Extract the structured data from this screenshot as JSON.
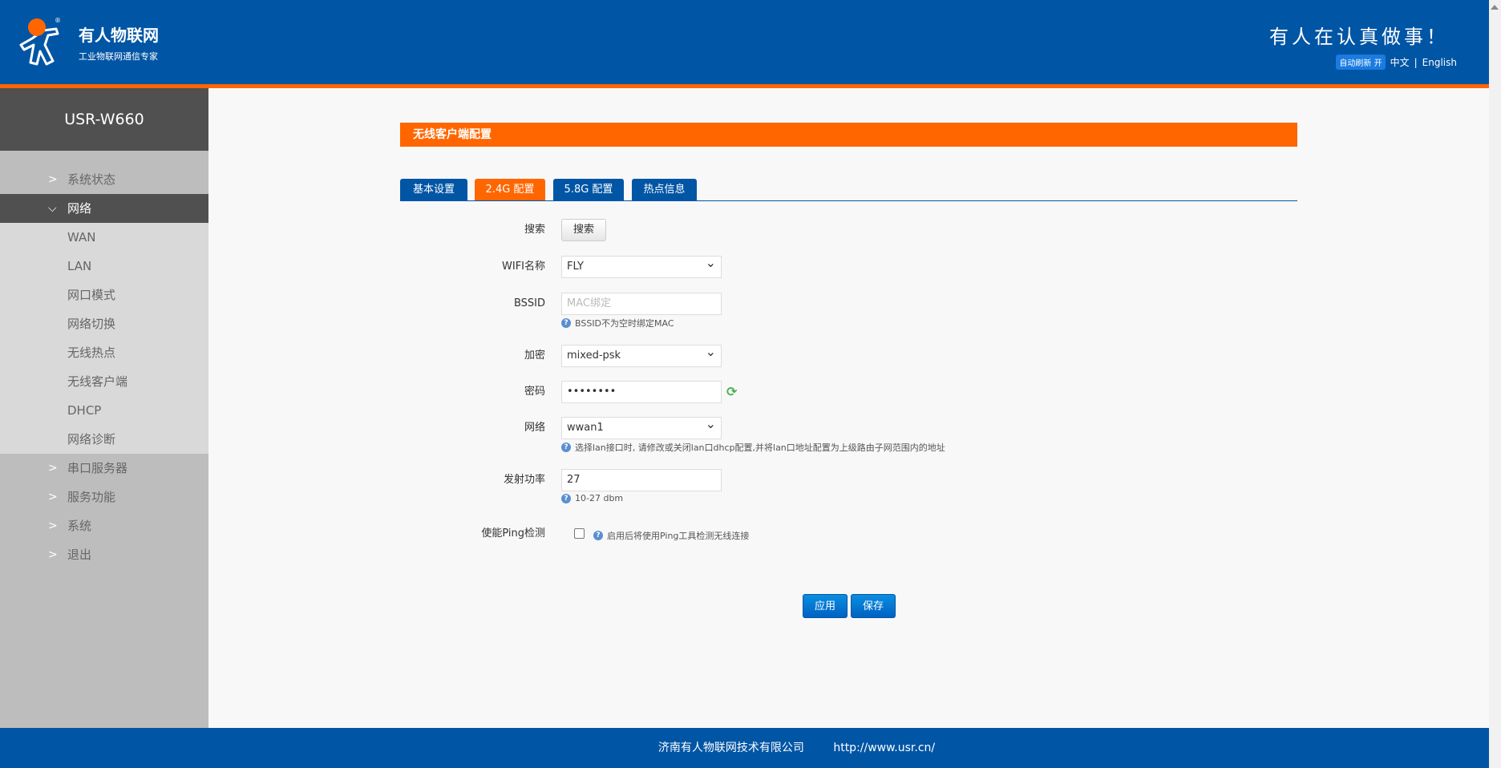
{
  "header": {
    "brand": "有人物联网",
    "brand_sub": "工业物联网通信专家",
    "slogan": "有人在认真做事！",
    "auto_refresh": "自动刷新 开",
    "lang_cn": "中文",
    "lang_sep": "|",
    "lang_en": "English"
  },
  "sidebar": {
    "title": "USR-W660",
    "items": [
      {
        "label": "系统状态"
      },
      {
        "label": "网络"
      },
      {
        "label": "WAN"
      },
      {
        "label": "LAN"
      },
      {
        "label": "网口模式"
      },
      {
        "label": "网络切换"
      },
      {
        "label": "无线热点"
      },
      {
        "label": "无线客户端"
      },
      {
        "label": "DHCP"
      },
      {
        "label": "网络诊断"
      },
      {
        "label": "串口服务器"
      },
      {
        "label": "服务功能"
      },
      {
        "label": "系统"
      },
      {
        "label": "退出"
      }
    ]
  },
  "main": {
    "title": "无线客户端配置",
    "tabs": [
      {
        "label": "基本设置"
      },
      {
        "label": "2.4G 配置"
      },
      {
        "label": "5.8G 配置"
      },
      {
        "label": "热点信息"
      }
    ],
    "form": {
      "search": {
        "label": "搜索",
        "button": "搜索"
      },
      "ssid": {
        "label": "WIFI名称",
        "value": "FLY"
      },
      "bssid": {
        "label": "BSSID",
        "placeholder": "MAC绑定",
        "help": "BSSID不为空时绑定MAC"
      },
      "encryption": {
        "label": "加密",
        "value": "mixed-psk"
      },
      "password": {
        "label": "密码",
        "value": "••••••••"
      },
      "network": {
        "label": "网络",
        "value": "wwan1",
        "help": "选择lan接口时, 请修改或关闭lan口dhcp配置,并将lan口地址配置为上级路由子网范围内的地址"
      },
      "txpower": {
        "label": "发射功率",
        "value": "27",
        "help": "10-27 dbm"
      },
      "ping": {
        "label": "使能Ping检测",
        "checked": false,
        "help": "启用后将使用Ping工具检测无线连接"
      }
    },
    "apply": "应用",
    "save": "保存"
  },
  "footer": {
    "company": "济南有人物联网技术有限公司",
    "url": "http://www.usr.cn/"
  },
  "colors": {
    "blue": "#0055a5",
    "orange": "#ff6600"
  }
}
